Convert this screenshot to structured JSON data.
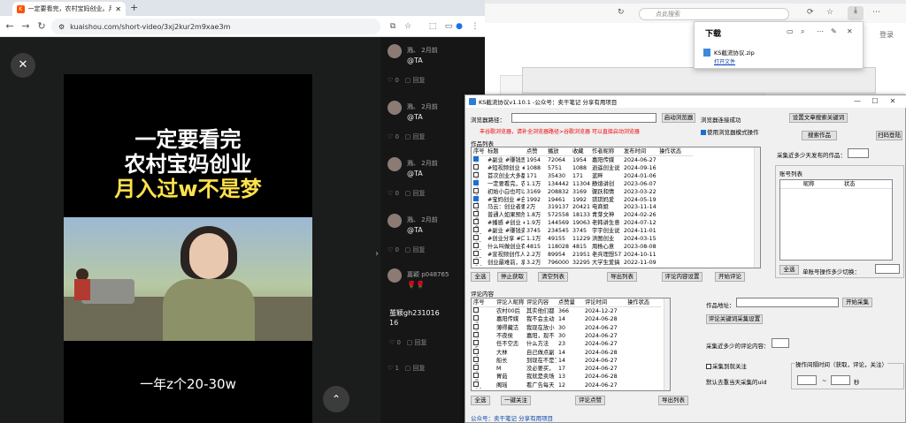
{
  "left_browser": {
    "tab_title": "一定要看完，农村宝妈创业。月",
    "new_tab": "+",
    "url": "kuaishou.com/short-video/3xj2kur2m9xae3m",
    "video": {
      "title_lines": [
        "一定要看完",
        "农村宝妈创业",
        "月入过w不是梦"
      ],
      "bottom_text": "一年z个20-30w"
    },
    "comments": [
      {
        "user": "溅、",
        "time": "2月前",
        "text": "@TA",
        "likes": "0",
        "reply": "回复"
      },
      {
        "user": "溅、",
        "time": "2月前",
        "text": "@TA",
        "likes": "0",
        "reply": "回复"
      },
      {
        "user": "溅、",
        "time": "2月前",
        "text": "@TA",
        "likes": "0",
        "reply": "回复"
      },
      {
        "user": "溅、",
        "time": "2月前",
        "text": "@TA",
        "likes": "0",
        "reply": "回复"
      },
      {
        "user": "嘉颖",
        "time": "p048765",
        "text": "🌹🌹",
        "likes": "",
        "reply": ""
      },
      {
        "user": "茧颖gh231016",
        "time": "",
        "text": "16",
        "likes": "0",
        "reply": "回复"
      },
      {
        "user": "",
        "time": "",
        "text": "",
        "likes": "1",
        "reply": "回复"
      }
    ]
  },
  "right_browser": {
    "search_placeholder": "点此搜索",
    "login": "登录",
    "download_popup": {
      "title": "下载",
      "file": "KS截流协议.zip",
      "open_file": "打开文件"
    }
  },
  "app": {
    "title": "KS截流协议v1.10.1 -公众号：卖干笔记 分享有用项目",
    "browser_path_label": "浏览器路径：",
    "browser_path_value": "",
    "start_browser": "启动浏览器",
    "browser_connect_status": "浏览器连接成功",
    "set_keyword_button": "设置文章搜索关键词",
    "warning": "丰谷歌浏览器，请补全浏览器路径>谷歌浏览器 可以直接启动浏览器",
    "use_browser_mode": "使用浏览器模式操作",
    "search_works": "搜索作品",
    "scan_login": "扫码登陆",
    "works_list_label": "作品列表",
    "recent_days_label": "采集近多少天发布的作品：",
    "recent_days_value": "",
    "works_columns": [
      "序号",
      "标题",
      "点赞",
      "播放",
      "收藏",
      "作者昵称",
      "发布时间",
      "操作状态"
    ],
    "works_rows": [
      {
        "no": "1",
        "checked": true,
        "title": "#副业 #赚钱思维",
        "likes": "1954",
        "plays": "72064",
        "fav": "1954",
        "author": "嘉阳传媒",
        "date": "2024-06-27",
        "status": ""
      },
      {
        "no": "2",
        "checked": false,
        "title": "#短视频创业 #口",
        "likes": "1088",
        "plays": "5751",
        "fav": "1088",
        "author": "逍遥创业说",
        "date": "2024-09-16",
        "status": ""
      },
      {
        "no": "3",
        "checked": false,
        "title": "首次创业大多都面",
        "likes": "171",
        "plays": "35430",
        "fav": "171",
        "author": "蓝畔",
        "date": "2024-01-06",
        "status": ""
      },
      {
        "no": "4",
        "checked": true,
        "title": "一定要看完，农村",
        "likes": "1.1万",
        "plays": "134442",
        "fav": "11304",
        "author": "静煊讲创",
        "date": "2023-06-07",
        "status": ""
      },
      {
        "no": "5",
        "checked": false,
        "title": "初始小白也可以静",
        "likes": "3169",
        "plays": "208832",
        "fav": "3169",
        "author": "骤跃和情",
        "date": "2023-03-22",
        "status": ""
      },
      {
        "no": "6",
        "checked": true,
        "title": "#宝妈创业 #自媒",
        "likes": "1992",
        "plays": "19461",
        "fav": "1992",
        "author": "琪琪妈爱",
        "date": "2024-05-19",
        "status": ""
      },
      {
        "no": "7",
        "checked": false,
        "title": "马云：创业者要坚",
        "likes": "2万",
        "plays": "319137",
        "fav": "20421",
        "author": "电商姐",
        "date": "2023-11-14",
        "status": ""
      },
      {
        "no": "8",
        "checked": false,
        "title": "普通人如果预然创",
        "likes": "1.8万",
        "plays": "572558",
        "fav": "18133",
        "author": "青芽文神",
        "date": "2024-02-26",
        "status": ""
      },
      {
        "no": "9",
        "checked": false,
        "title": "#播感 #创业 #轻",
        "likes": "1.9万",
        "plays": "144569",
        "fav": "19063",
        "author": "老韩讲生意",
        "date": "2024-07-12",
        "status": ""
      },
      {
        "no": "10",
        "checked": false,
        "title": "#副业 #赚钱资源",
        "likes": "3745",
        "plays": "234545",
        "fav": "3745",
        "author": "宇宇创业说",
        "date": "2024-11-01",
        "status": ""
      },
      {
        "no": "11",
        "checked": false,
        "title": "#创业分享 #口播",
        "likes": "1.1万",
        "plays": "49155",
        "fav": "11229",
        "author": "洪图创业",
        "date": "2024-03-15",
        "status": ""
      },
      {
        "no": "12",
        "checked": false,
        "title": "什么叫做创业有心",
        "likes": "4815",
        "plays": "118028",
        "fav": "4815",
        "author": "周杨心意",
        "date": "2023-08-08",
        "status": ""
      },
      {
        "no": "13",
        "checked": false,
        "title": "#宣视频创作人 #",
        "likes": "2.2万",
        "plays": "89954",
        "fav": "21951",
        "author": "老兵理想577",
        "date": "2024-10-11",
        "status": ""
      },
      {
        "no": "14",
        "checked": false,
        "title": "创业最难前，承不",
        "likes": "3.2万",
        "plays": "796000",
        "fav": "32295",
        "author": "大学生爱搞",
        "date": "2022-11-09",
        "status": ""
      }
    ],
    "works_buttons": [
      "全选",
      "停止获取",
      "清空列表",
      "导出列表",
      "评论内容设置",
      "开始评论"
    ],
    "account_list_label": "账号列表",
    "account_columns": [
      "",
      "昵称",
      "状态"
    ],
    "account_select_all": "全选",
    "account_switch_label": "单账号操作多少切换：",
    "account_switch_value": "",
    "comment_label": "评论内容",
    "comment_columns": [
      "序号",
      "评论人昵称",
      "评论内容",
      "点赞量",
      "评论时间",
      "操作状态"
    ],
    "comment_rows": [
      {
        "no": "1",
        "nick": "农村00后",
        "content": "其实他们都",
        "likes": "366",
        "date": "2024-12-27"
      },
      {
        "no": "2",
        "nick": "嘉阳传媒",
        "content": "我不会主动",
        "likes": "14",
        "date": "2024-06-28"
      },
      {
        "no": "3",
        "nick": "薄得藏洁",
        "content": "我现在放小",
        "likes": "30",
        "date": "2024-06-27"
      },
      {
        "no": "4",
        "nick": "不夜侯",
        "content": "嘉阳，现不",
        "likes": "30",
        "date": "2024-06-27"
      },
      {
        "no": "5",
        "nick": "任不空恋",
        "content": "什么方法",
        "likes": "23",
        "date": "2024-06-27"
      },
      {
        "no": "6",
        "nick": "大林",
        "content": "自己做点副",
        "likes": "14",
        "date": "2024-06-28"
      },
      {
        "no": "7",
        "nick": "船长",
        "content": "到现在不是了",
        "likes": "14",
        "date": "2024-06-27"
      },
      {
        "no": "8",
        "nick": "M",
        "content": "没必要买，",
        "likes": "17",
        "date": "2024-06-27"
      },
      {
        "no": "9",
        "nick": "胃茹",
        "content": "我就是卖场",
        "likes": "13",
        "date": "2024-06-28"
      },
      {
        "no": "10",
        "nick": "阁瑶",
        "content": "看广告每天",
        "likes": "12",
        "date": "2024-06-27"
      }
    ],
    "comment_buttons": [
      "全选",
      "一键关注",
      "评论点赞",
      "导出列表"
    ],
    "work_address_label": "作品地址：",
    "work_address_value": "",
    "start_collect": "开始采集",
    "comment_keyword_button": "评论关键词采集设置",
    "recent_days_comment_label": "采集近多少的评论内容：",
    "recent_days_comment_value": "",
    "auto_follow": "采集到就关注",
    "default_unfollowed": "默认去重当天采集的uid",
    "interval_label": "操作间隔时间（获取，评论，关注）",
    "interval_from": "",
    "interval_sep": "~",
    "interval_unit": "秒",
    "footer": "公众号：卖干笔记 分享有用项目"
  }
}
